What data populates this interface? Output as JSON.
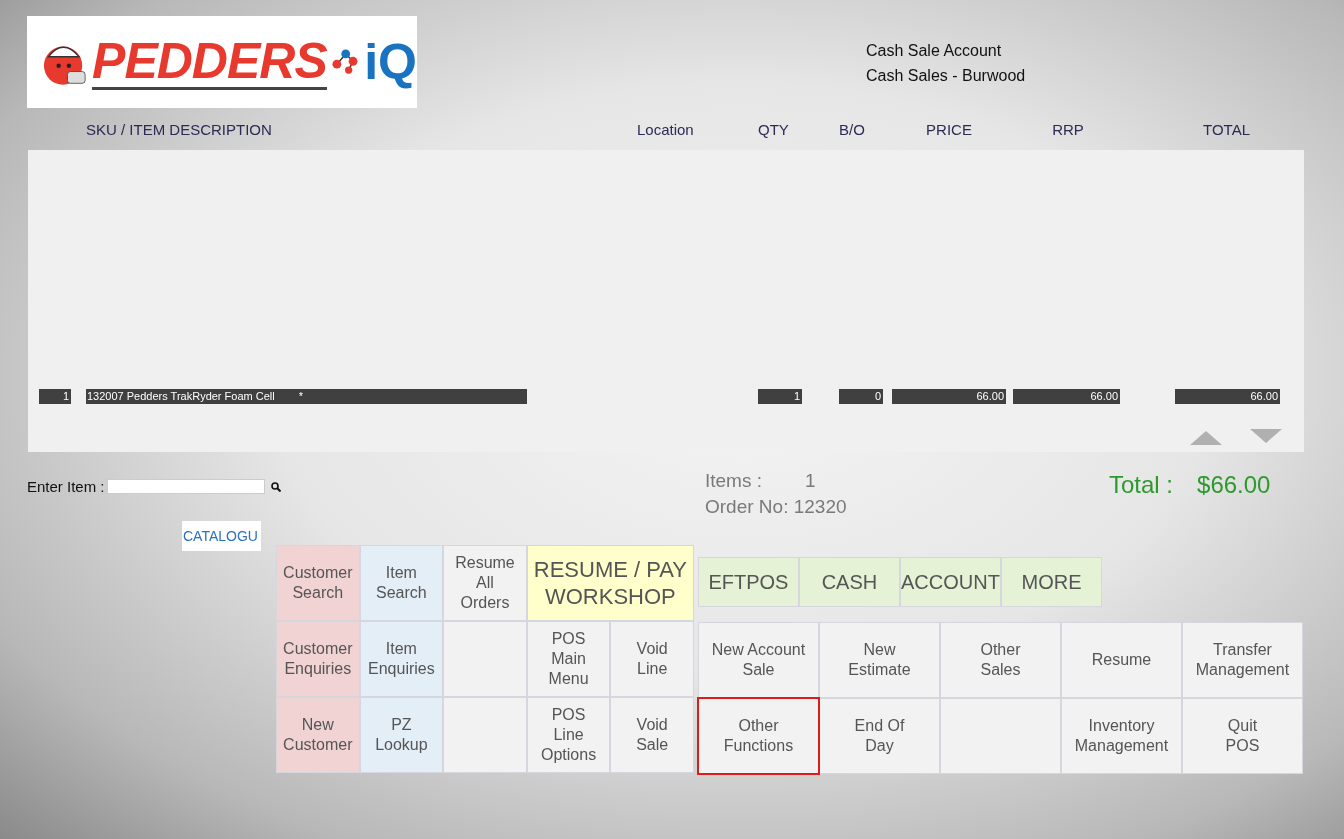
{
  "header": {
    "logo": {
      "brand": "PEDDERS",
      "suffix": "iQ"
    },
    "account_lines": [
      "Cash Sale Account",
      "Cash Sales - Burwood"
    ]
  },
  "table": {
    "columns": [
      "SKU / ITEM DESCRIPTION",
      "Location",
      "QTY",
      "B/O",
      "PRICE",
      "RRP",
      "TOTAL"
    ],
    "rows": [
      {
        "line": "1",
        "description": "132007 Pedders TrakRyder Foam Cell",
        "flag": "*",
        "qty": "1",
        "bo": "0",
        "price": "66.00",
        "rrp": "66.00",
        "total": "66.00"
      }
    ]
  },
  "entry": {
    "label": "Enter Item :"
  },
  "summary": {
    "items_label": "Items :",
    "items_value": "1",
    "order_label": "Order No:",
    "order_value": "12320",
    "total_label": "Total :",
    "total_value": "$66.00"
  },
  "catalogue_button": "CATALOGU",
  "left_buttons": [
    {
      "kind": "action",
      "label": "Customer\nSearch",
      "color": "#f2d3d3",
      "highlighted": false
    },
    {
      "kind": "action",
      "label": "Item\nSearch",
      "color": "#e4eef7",
      "highlighted": false
    },
    {
      "kind": "action",
      "label": "Resume\nAll\nOrders",
      "color": "#f2f2f2",
      "highlighted": false
    },
    {
      "kind": "wide",
      "label": "RESUME / PAY\nWORKSHOP",
      "color": "#ffffcc",
      "highlighted": false
    },
    {
      "kind": "action",
      "label": "Customer\nEnquiries",
      "color": "#f2d3d3",
      "highlighted": false
    },
    {
      "kind": "action",
      "label": "Item\nEnquiries",
      "color": "#e4eef7",
      "highlighted": false
    },
    {
      "kind": "blank",
      "color": "#f2f2f2",
      "highlighted": false
    },
    {
      "kind": "action",
      "label": "POS\nMain\nMenu",
      "color": "#f2f2f2",
      "highlighted": false
    },
    {
      "kind": "action",
      "label": "Void\nLine",
      "color": "#f2f2f2",
      "highlighted": false
    },
    {
      "kind": "action",
      "label": "New\nCustomer",
      "color": "#f2d3d3",
      "highlighted": false
    },
    {
      "kind": "action",
      "label": "PZ\nLookup",
      "color": "#e4eef7",
      "highlighted": false
    },
    {
      "kind": "blank",
      "color": "#f2f2f2",
      "highlighted": false
    },
    {
      "kind": "action",
      "label": "POS\nLine\nOptions",
      "color": "#f2f2f2",
      "highlighted": false
    },
    {
      "kind": "action",
      "label": "Void\nSale",
      "color": "#f2f2f2",
      "highlighted": false
    }
  ],
  "payment_buttons": [
    {
      "label": "EFTPOS",
      "color": "#e5f2d5"
    },
    {
      "label": "CASH",
      "color": "#e5f2d5"
    },
    {
      "label": "ACCOUNT",
      "color": "#e5f2d5"
    },
    {
      "label": "MORE",
      "color": "#e5f2d5"
    }
  ],
  "function_buttons": [
    {
      "kind": "action",
      "label": "New Account\nSale",
      "highlighted": false
    },
    {
      "kind": "action",
      "label": "New\nEstimate",
      "highlighted": false
    },
    {
      "kind": "action",
      "label": "Other\nSales",
      "highlighted": false
    },
    {
      "kind": "action",
      "label": "Resume",
      "highlighted": false
    },
    {
      "kind": "action",
      "label": "Transfer\nManagement",
      "highlighted": false
    },
    {
      "kind": "action",
      "label": "Other\nFunctions",
      "highlighted": true
    },
    {
      "kind": "action",
      "label": "End Of\nDay",
      "highlighted": false
    },
    {
      "kind": "blank",
      "highlighted": false
    },
    {
      "kind": "action",
      "label": "Inventory\nManagement",
      "highlighted": false
    },
    {
      "kind": "action",
      "label": "Quit\nPOS",
      "highlighted": false
    }
  ]
}
